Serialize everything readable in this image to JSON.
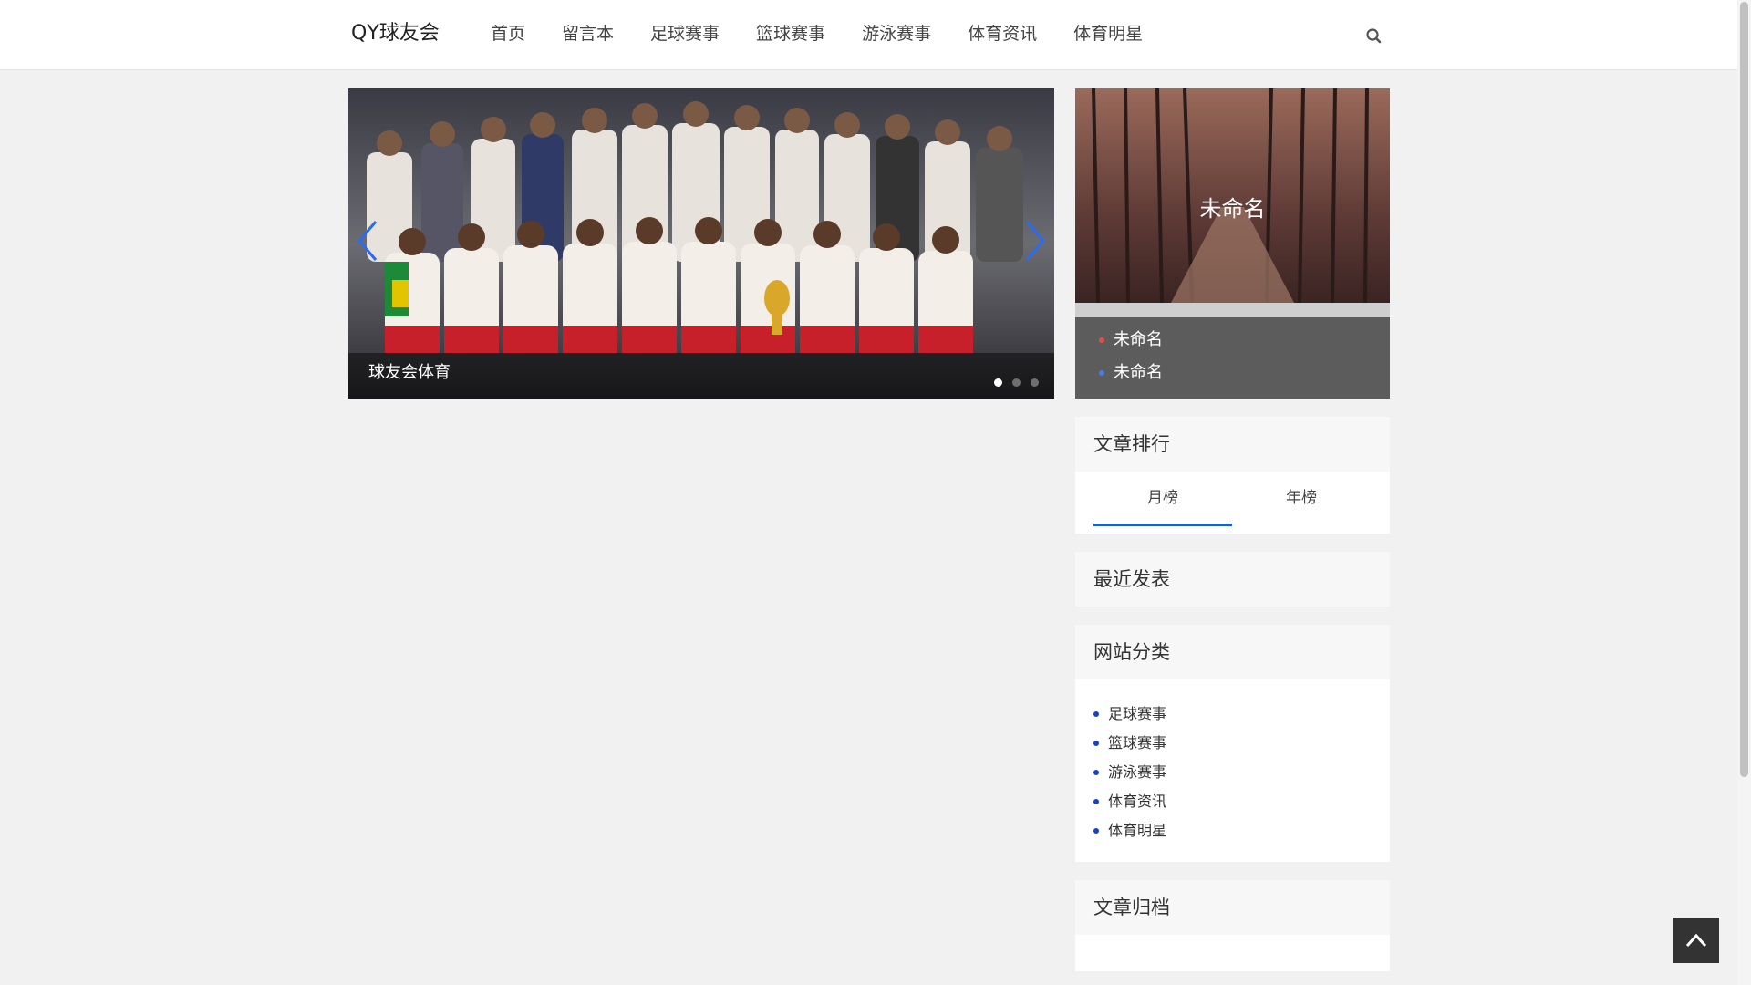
{
  "header": {
    "logo": "QY球友会",
    "nav": [
      "首页",
      "留言本",
      "足球赛事",
      "篮球赛事",
      "游泳赛事",
      "体育资讯",
      "体育明星"
    ],
    "search_icon": "search-icon"
  },
  "slider": {
    "caption": "球友会体育",
    "dots": 3,
    "active_dot": 1,
    "arrows": [
      "chevron-left-icon",
      "chevron-right-icon"
    ]
  },
  "featured": {
    "title": "未命名",
    "items": [
      {
        "label": "未命名",
        "dot_color": "#e94b4b"
      },
      {
        "label": "未命名",
        "dot_color": "#4b7ae9"
      }
    ]
  },
  "widgets": {
    "ranking": {
      "title": "文章排行",
      "tabs": [
        "月榜",
        "年榜"
      ],
      "active_tab": 0
    },
    "recent": {
      "title": "最近发表"
    },
    "categories": {
      "title": "网站分类",
      "items": [
        "足球赛事",
        "篮球赛事",
        "游泳赛事",
        "体育资讯",
        "体育明星"
      ]
    },
    "archive": {
      "title": "文章归档"
    }
  },
  "colors": {
    "accent": "#1f5fbf",
    "dot_blue": "#1a3fcf",
    "back_top": "#333333"
  },
  "back_to_top_icon": "chevron-up-icon"
}
